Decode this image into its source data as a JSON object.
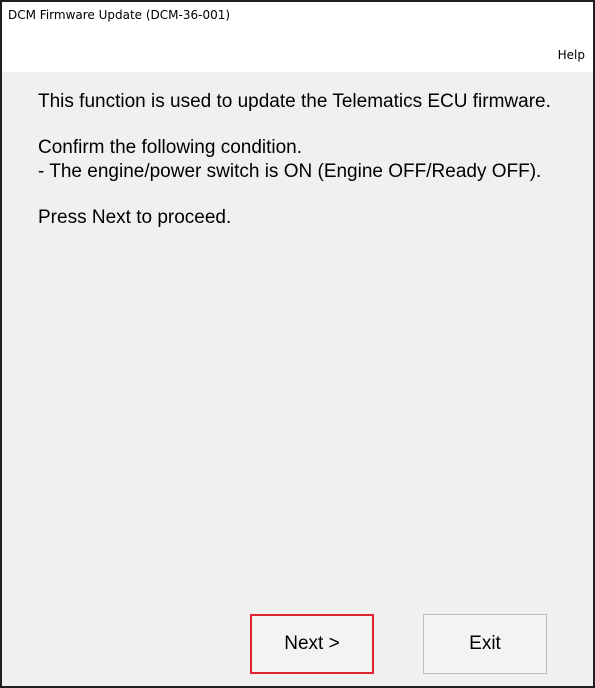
{
  "window": {
    "title": "DCM Firmware Update (DCM-36-001)"
  },
  "menu": {
    "help_label": "Help"
  },
  "content": {
    "paragraphs": [
      "This function is used to update the Telematics ECU firmware.",
      "Confirm the following condition.\n- The engine/power switch is ON (Engine OFF/Ready OFF).",
      "Press Next to proceed."
    ]
  },
  "buttons": {
    "next_label": "Next >",
    "exit_label": "Exit",
    "highlight_color": "#e0242f"
  }
}
